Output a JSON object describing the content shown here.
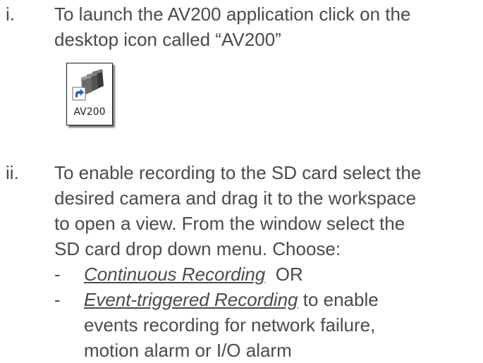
{
  "step1": {
    "number": "i.",
    "line1": "To launch the AV200 application click on the",
    "line2": "desktop icon called “AV200”",
    "icon": {
      "name": "av200-shortcut-icon",
      "label": "AV200"
    }
  },
  "step2": {
    "number": "ii.",
    "lines": [
      "To enable recording to the SD card select the",
      "desired camera and drag it to the workspace",
      "to open a view.  From the window select the",
      "SD card drop down menu.  Choose:"
    ],
    "options": [
      {
        "dash": "-",
        "emph": "Continuous Recording",
        "rest": "  OR",
        "more": []
      },
      {
        "dash": "-",
        "emph": "Event-triggered Recording",
        "rest": " to enable",
        "more": [
          "events recording for network failure,",
          "motion alarm or I/O alarm"
        ]
      }
    ]
  }
}
